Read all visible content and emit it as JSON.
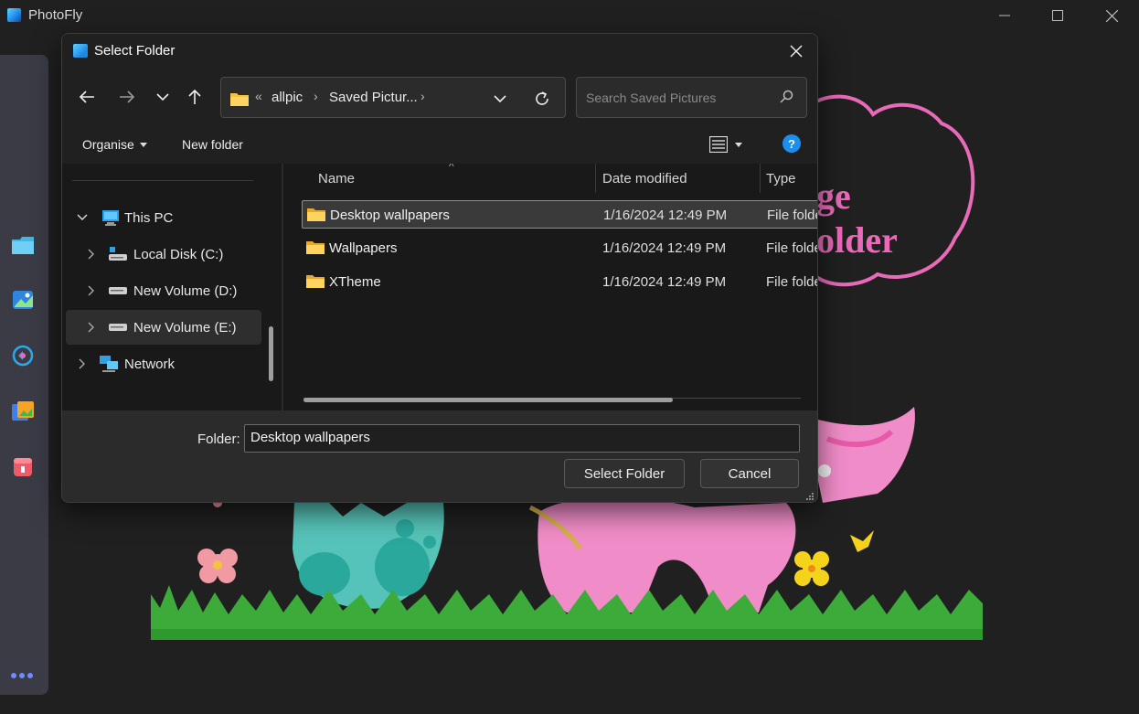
{
  "app": {
    "title": "PhotoFly"
  },
  "dialog": {
    "title": "Select Folder",
    "address": {
      "crumb_prefix": "«",
      "crumb_1": "allpic",
      "crumb_2": "Saved Pictur...",
      "sep": "›"
    },
    "search_placeholder": "Search Saved Pictures",
    "toolbar": {
      "organise": "Organise",
      "new_folder": "New folder",
      "help": "?"
    },
    "tree": [
      {
        "label": "This PC",
        "icon": "computer-icon",
        "expanded": true
      },
      {
        "label": "Local Disk (C:)",
        "icon": "drive-icon"
      },
      {
        "label": "New Volume (D:)",
        "icon": "drive-icon"
      },
      {
        "label": "New Volume (E:)",
        "icon": "drive-icon",
        "selected": true
      },
      {
        "label": "Network",
        "icon": "network-icon"
      }
    ],
    "columns": {
      "name": "Name",
      "date": "Date modified",
      "type": "Type"
    },
    "rows": [
      {
        "name": "Desktop wallpapers",
        "date": "1/16/2024 12:49 PM",
        "type": "File folder",
        "selected": true
      },
      {
        "name": "Wallpapers",
        "date": "1/16/2024 12:49 PM",
        "type": "File folder"
      },
      {
        "name": "XTheme",
        "date": "1/16/2024 12:49 PM",
        "type": "File folder"
      }
    ],
    "footer": {
      "folder_label": "Folder:",
      "folder_value": "Desktop wallpapers",
      "select_button": "Select Folder",
      "cancel_button": "Cancel"
    }
  },
  "background_text": {
    "line1": "ge",
    "line2": "older"
  },
  "colors": {
    "accent": "#1a8ff0",
    "folder": "#f5c144",
    "pink": "#e86ab8",
    "grass": "#3dab3a"
  }
}
